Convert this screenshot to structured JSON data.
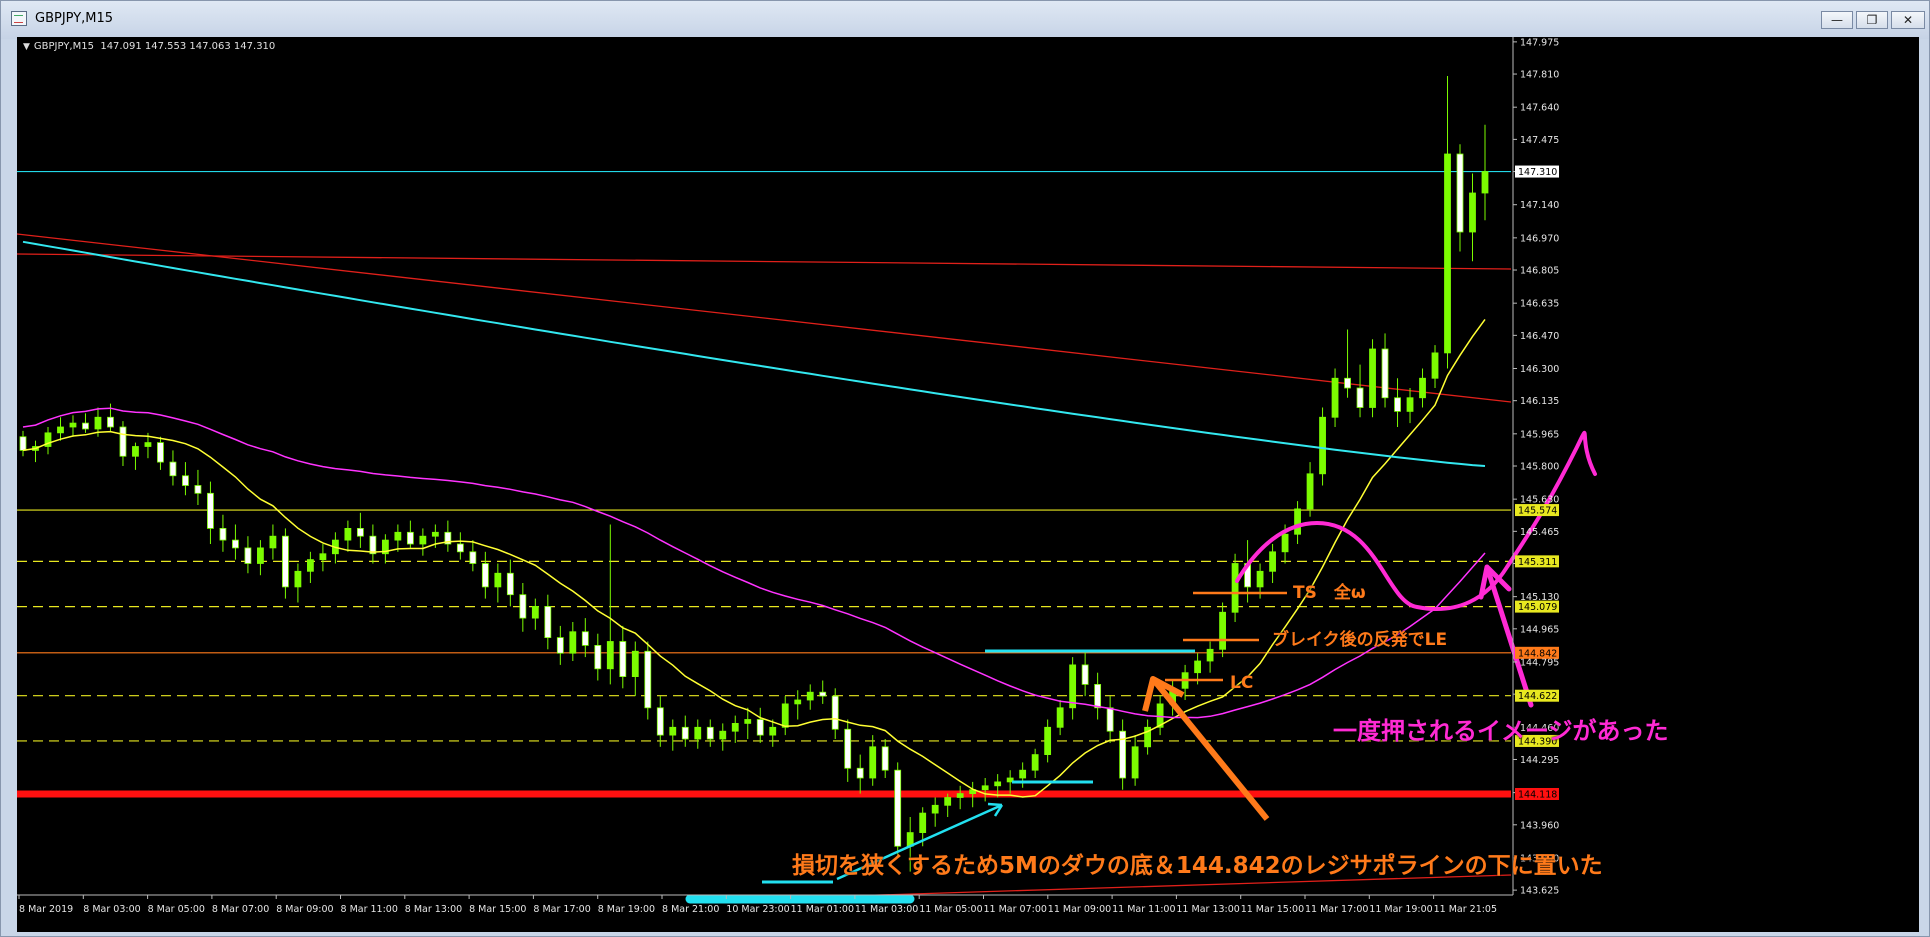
{
  "window": {
    "title": "GBPJPY,M15",
    "minimize_label": "—",
    "restore_label": "❐",
    "close_label": "✕"
  },
  "chart_header": {
    "symbol": "GBPJPY,M15",
    "ohlc": "147.091 147.553 147.063 147.310"
  },
  "colors": {
    "background": "#000000",
    "candle_bull": "#7cfc00",
    "candle_bear": "#ffffff",
    "ma_short": "#ffff33",
    "ma_mid": "#ff33ff",
    "ma_long": "#33e8f0",
    "trendline": "#e0201a",
    "support_line": "#ff1010",
    "annotation_orange": "#ff7a1a",
    "annotation_magenta": "#ff2ad4",
    "annotation_cyan": "#22e0f0"
  },
  "annotations": {
    "ts_label": "TS　全ω",
    "entry_label": "ブレイク後の反発でLE",
    "lc_label": "LC",
    "image_label": "一度押されるイメージがあった",
    "stop_label": "損切を狭くするため5Mのダウの底＆144.842のレジサポラインの下に置いた"
  },
  "chart_data": {
    "type": "candlestick",
    "symbol": "GBPJPY",
    "timeframe": "M15",
    "ylim": [
      143.6,
      148.0
    ],
    "y_ticks": [
      "147.975",
      "147.810",
      "147.640",
      "147.475",
      "147.310",
      "147.140",
      "146.970",
      "146.805",
      "146.635",
      "146.470",
      "146.300",
      "146.135",
      "145.965",
      "145.800",
      "145.630",
      "145.465",
      "145.300",
      "145.130",
      "144.965",
      "144.795",
      "144.630",
      "144.460",
      "144.295",
      "144.125",
      "143.960",
      "143.790",
      "143.625"
    ],
    "x_ticks": [
      "8 Mar 2019",
      "8 Mar 03:00",
      "8 Mar 05:00",
      "8 Mar 07:00",
      "8 Mar 09:00",
      "8 Mar 11:00",
      "8 Mar 13:00",
      "8 Mar 15:00",
      "8 Mar 17:00",
      "8 Mar 19:00",
      "8 Mar 21:00",
      "10 Mar 23:00",
      "11 Mar 01:00",
      "11 Mar 03:00",
      "11 Mar 05:00",
      "11 Mar 07:00",
      "11 Mar 09:00",
      "11 Mar 11:00",
      "11 Mar 13:00",
      "11 Mar 15:00",
      "11 Mar 17:00",
      "11 Mar 19:00",
      "11 Mar 21:05"
    ],
    "current_price": 147.31,
    "horizontal_levels": [
      {
        "price": 147.31,
        "label": "147.310",
        "style": "solid",
        "color": "#22d8e8"
      },
      {
        "price": 145.574,
        "label": "145.574",
        "style": "solid",
        "color": "#e8e820"
      },
      {
        "price": 145.311,
        "label": "145.311",
        "style": "dashed",
        "color": "#e8e820"
      },
      {
        "price": 145.079,
        "label": "145.079",
        "style": "dashed",
        "color": "#e8e820"
      },
      {
        "price": 144.842,
        "label": "144.842",
        "style": "solid",
        "color": "#ff7a1a"
      },
      {
        "price": 144.622,
        "label": "144.622",
        "style": "dashed",
        "color": "#e8e820"
      },
      {
        "price": 144.39,
        "label": "144.390",
        "style": "dashed",
        "color": "#e8e820"
      },
      {
        "price": 144.118,
        "label": "144.118",
        "style": "thick",
        "color": "#ff1010"
      }
    ],
    "candles": [
      [
        145.95,
        145.98,
        145.85,
        145.88
      ],
      [
        145.88,
        145.93,
        145.82,
        145.9
      ],
      [
        145.9,
        146.0,
        145.86,
        145.97
      ],
      [
        145.97,
        146.05,
        145.93,
        146.0
      ],
      [
        146.0,
        146.06,
        145.95,
        146.02
      ],
      [
        146.02,
        146.07,
        145.97,
        145.99
      ],
      [
        145.99,
        146.1,
        145.95,
        146.05
      ],
      [
        146.05,
        146.12,
        145.98,
        146.0
      ],
      [
        146.0,
        146.03,
        145.8,
        145.85
      ],
      [
        145.85,
        145.92,
        145.78,
        145.9
      ],
      [
        145.9,
        145.97,
        145.84,
        145.92
      ],
      [
        145.92,
        145.95,
        145.78,
        145.82
      ],
      [
        145.82,
        145.88,
        145.7,
        145.75
      ],
      [
        145.75,
        145.82,
        145.65,
        145.7
      ],
      [
        145.7,
        145.78,
        145.6,
        145.66
      ],
      [
        145.66,
        145.72,
        145.4,
        145.48
      ],
      [
        145.48,
        145.55,
        145.36,
        145.42
      ],
      [
        145.42,
        145.5,
        145.32,
        145.38
      ],
      [
        145.38,
        145.44,
        145.25,
        145.3
      ],
      [
        145.3,
        145.42,
        145.24,
        145.38
      ],
      [
        145.38,
        145.5,
        145.32,
        145.44
      ],
      [
        145.44,
        145.48,
        145.12,
        145.18
      ],
      [
        145.18,
        145.3,
        145.1,
        145.26
      ],
      [
        145.26,
        145.36,
        145.2,
        145.32
      ],
      [
        145.32,
        145.4,
        145.26,
        145.35
      ],
      [
        145.35,
        145.46,
        145.3,
        145.42
      ],
      [
        145.42,
        145.52,
        145.36,
        145.48
      ],
      [
        145.48,
        145.56,
        145.38,
        145.44
      ],
      [
        145.44,
        145.5,
        145.3,
        145.35
      ],
      [
        145.35,
        145.45,
        145.3,
        145.42
      ],
      [
        145.42,
        145.5,
        145.36,
        145.46
      ],
      [
        145.46,
        145.52,
        145.38,
        145.4
      ],
      [
        145.4,
        145.48,
        145.34,
        145.44
      ],
      [
        145.44,
        145.5,
        145.38,
        145.46
      ],
      [
        145.46,
        145.52,
        145.36,
        145.4
      ],
      [
        145.4,
        145.46,
        145.32,
        145.36
      ],
      [
        145.36,
        145.42,
        145.26,
        145.3
      ],
      [
        145.3,
        145.36,
        145.12,
        145.18
      ],
      [
        145.18,
        145.3,
        145.1,
        145.25
      ],
      [
        145.25,
        145.32,
        145.08,
        145.14
      ],
      [
        145.14,
        145.2,
        144.95,
        145.02
      ],
      [
        145.02,
        145.12,
        144.96,
        145.08
      ],
      [
        145.08,
        145.14,
        144.86,
        144.92
      ],
      [
        144.92,
        144.98,
        144.78,
        144.84
      ],
      [
        144.84,
        145.0,
        144.8,
        144.95
      ],
      [
        144.95,
        145.02,
        144.82,
        144.88
      ],
      [
        144.88,
        144.94,
        144.7,
        144.76
      ],
      [
        144.76,
        145.5,
        144.68,
        144.9
      ],
      [
        144.9,
        144.98,
        144.66,
        144.72
      ],
      [
        144.72,
        144.9,
        144.62,
        144.85
      ],
      [
        144.85,
        144.9,
        144.5,
        144.56
      ],
      [
        144.56,
        144.62,
        144.36,
        144.42
      ],
      [
        144.42,
        144.5,
        144.34,
        144.46
      ],
      [
        144.46,
        144.52,
        144.36,
        144.4
      ],
      [
        144.4,
        144.5,
        144.35,
        144.46
      ],
      [
        144.46,
        144.5,
        144.36,
        144.4
      ],
      [
        144.4,
        144.48,
        144.34,
        144.44
      ],
      [
        144.44,
        144.52,
        144.38,
        144.48
      ],
      [
        144.48,
        144.56,
        144.4,
        144.5
      ],
      [
        144.5,
        144.56,
        144.38,
        144.42
      ],
      [
        144.42,
        144.5,
        144.36,
        144.46
      ],
      [
        144.46,
        144.62,
        144.42,
        144.58
      ],
      [
        144.58,
        144.65,
        144.5,
        144.6
      ],
      [
        144.6,
        144.68,
        144.55,
        144.64
      ],
      [
        144.64,
        144.7,
        144.58,
        144.62
      ],
      [
        144.62,
        144.66,
        144.4,
        144.45
      ],
      [
        144.45,
        144.5,
        144.18,
        144.25
      ],
      [
        144.25,
        144.32,
        144.12,
        144.2
      ],
      [
        144.2,
        144.42,
        144.16,
        144.36
      ],
      [
        144.36,
        144.4,
        144.2,
        144.24
      ],
      [
        144.24,
        144.28,
        143.8,
        143.85
      ],
      [
        143.85,
        144.0,
        143.72,
        143.92
      ],
      [
        143.92,
        144.05,
        143.85,
        144.02
      ],
      [
        144.02,
        144.1,
        143.95,
        144.06
      ],
      [
        144.06,
        144.12,
        144.0,
        144.1
      ],
      [
        144.1,
        144.16,
        144.04,
        144.12
      ],
      [
        144.12,
        144.18,
        144.05,
        144.14
      ],
      [
        144.14,
        144.2,
        144.08,
        144.16
      ],
      [
        144.16,
        144.22,
        144.1,
        144.18
      ],
      [
        144.18,
        144.24,
        144.12,
        144.2
      ],
      [
        144.2,
        144.28,
        144.15,
        144.24
      ],
      [
        144.24,
        144.35,
        144.2,
        144.32
      ],
      [
        144.32,
        144.5,
        144.28,
        144.46
      ],
      [
        144.46,
        144.6,
        144.42,
        144.56
      ],
      [
        144.56,
        144.82,
        144.5,
        144.78
      ],
      [
        144.78,
        144.85,
        144.62,
        144.68
      ],
      [
        144.68,
        144.74,
        144.5,
        144.56
      ],
      [
        144.56,
        144.62,
        144.38,
        144.44
      ],
      [
        144.44,
        144.5,
        144.14,
        144.2
      ],
      [
        144.2,
        144.42,
        144.16,
        144.36
      ],
      [
        144.36,
        144.5,
        144.32,
        144.46
      ],
      [
        144.46,
        144.62,
        144.42,
        144.58
      ],
      [
        144.58,
        144.7,
        144.52,
        144.66
      ],
      [
        144.66,
        144.78,
        144.6,
        144.74
      ],
      [
        144.74,
        144.84,
        144.68,
        144.8
      ],
      [
        144.8,
        144.9,
        144.74,
        144.86
      ],
      [
        144.86,
        145.1,
        144.82,
        145.05
      ],
      [
        145.05,
        145.35,
        145.0,
        145.3
      ],
      [
        145.3,
        145.42,
        145.1,
        145.18
      ],
      [
        145.18,
        145.3,
        145.12,
        145.26
      ],
      [
        145.26,
        145.4,
        145.2,
        145.36
      ],
      [
        145.36,
        145.5,
        145.3,
        145.45
      ],
      [
        145.45,
        145.62,
        145.4,
        145.58
      ],
      [
        145.58,
        145.82,
        145.54,
        145.76
      ],
      [
        145.76,
        146.1,
        145.7,
        146.05
      ],
      [
        146.05,
        146.3,
        146.0,
        146.25
      ],
      [
        146.25,
        146.5,
        146.15,
        146.2
      ],
      [
        146.2,
        146.32,
        146.05,
        146.1
      ],
      [
        146.1,
        146.45,
        146.05,
        146.4
      ],
      [
        146.4,
        146.48,
        146.1,
        146.15
      ],
      [
        146.15,
        146.25,
        146.0,
        146.08
      ],
      [
        146.08,
        146.2,
        146.02,
        146.15
      ],
      [
        146.15,
        146.3,
        146.1,
        146.25
      ],
      [
        146.25,
        146.42,
        146.2,
        146.38
      ],
      [
        146.38,
        147.8,
        146.3,
        147.4
      ],
      [
        147.4,
        147.45,
        146.9,
        147.0
      ],
      [
        147.0,
        147.3,
        146.85,
        147.2
      ],
      [
        147.2,
        147.55,
        147.06,
        147.31
      ]
    ]
  }
}
